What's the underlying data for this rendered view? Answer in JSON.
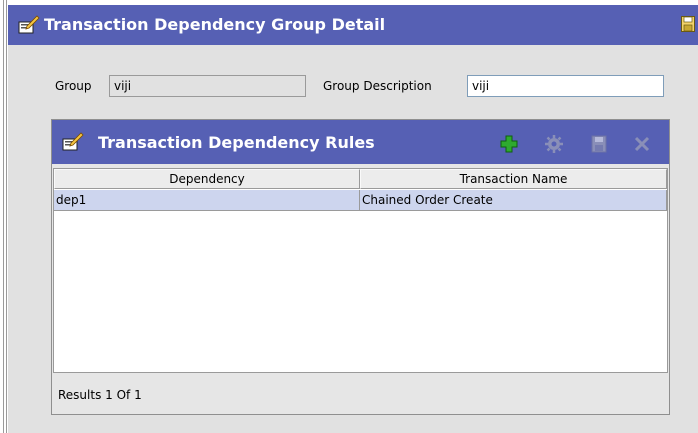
{
  "window": {
    "title": "Transaction Dependency Group Detail",
    "title_icon": "edit-detail-icon",
    "save_icon": "save-icon"
  },
  "form": {
    "group_label": "Group",
    "group_value": "viji",
    "group_description_label": "Group Description",
    "group_description_value": "viji"
  },
  "rules": {
    "title": "Transaction Dependency Rules",
    "toolbar": {
      "add_icon": "add-icon",
      "details_icon": "details-icon",
      "save_icon": "save-icon",
      "delete_icon": "delete-icon"
    },
    "columns": [
      "Dependency",
      "Transaction Name"
    ],
    "rows": [
      {
        "dependency": "dep1",
        "transaction_name": "Chained Order Create"
      }
    ],
    "results": "Results 1  Of 1"
  },
  "colors": {
    "header_blue": "#5660b4",
    "panel_gray": "#e1e1e1",
    "selected_row": "#cdd5ee"
  }
}
